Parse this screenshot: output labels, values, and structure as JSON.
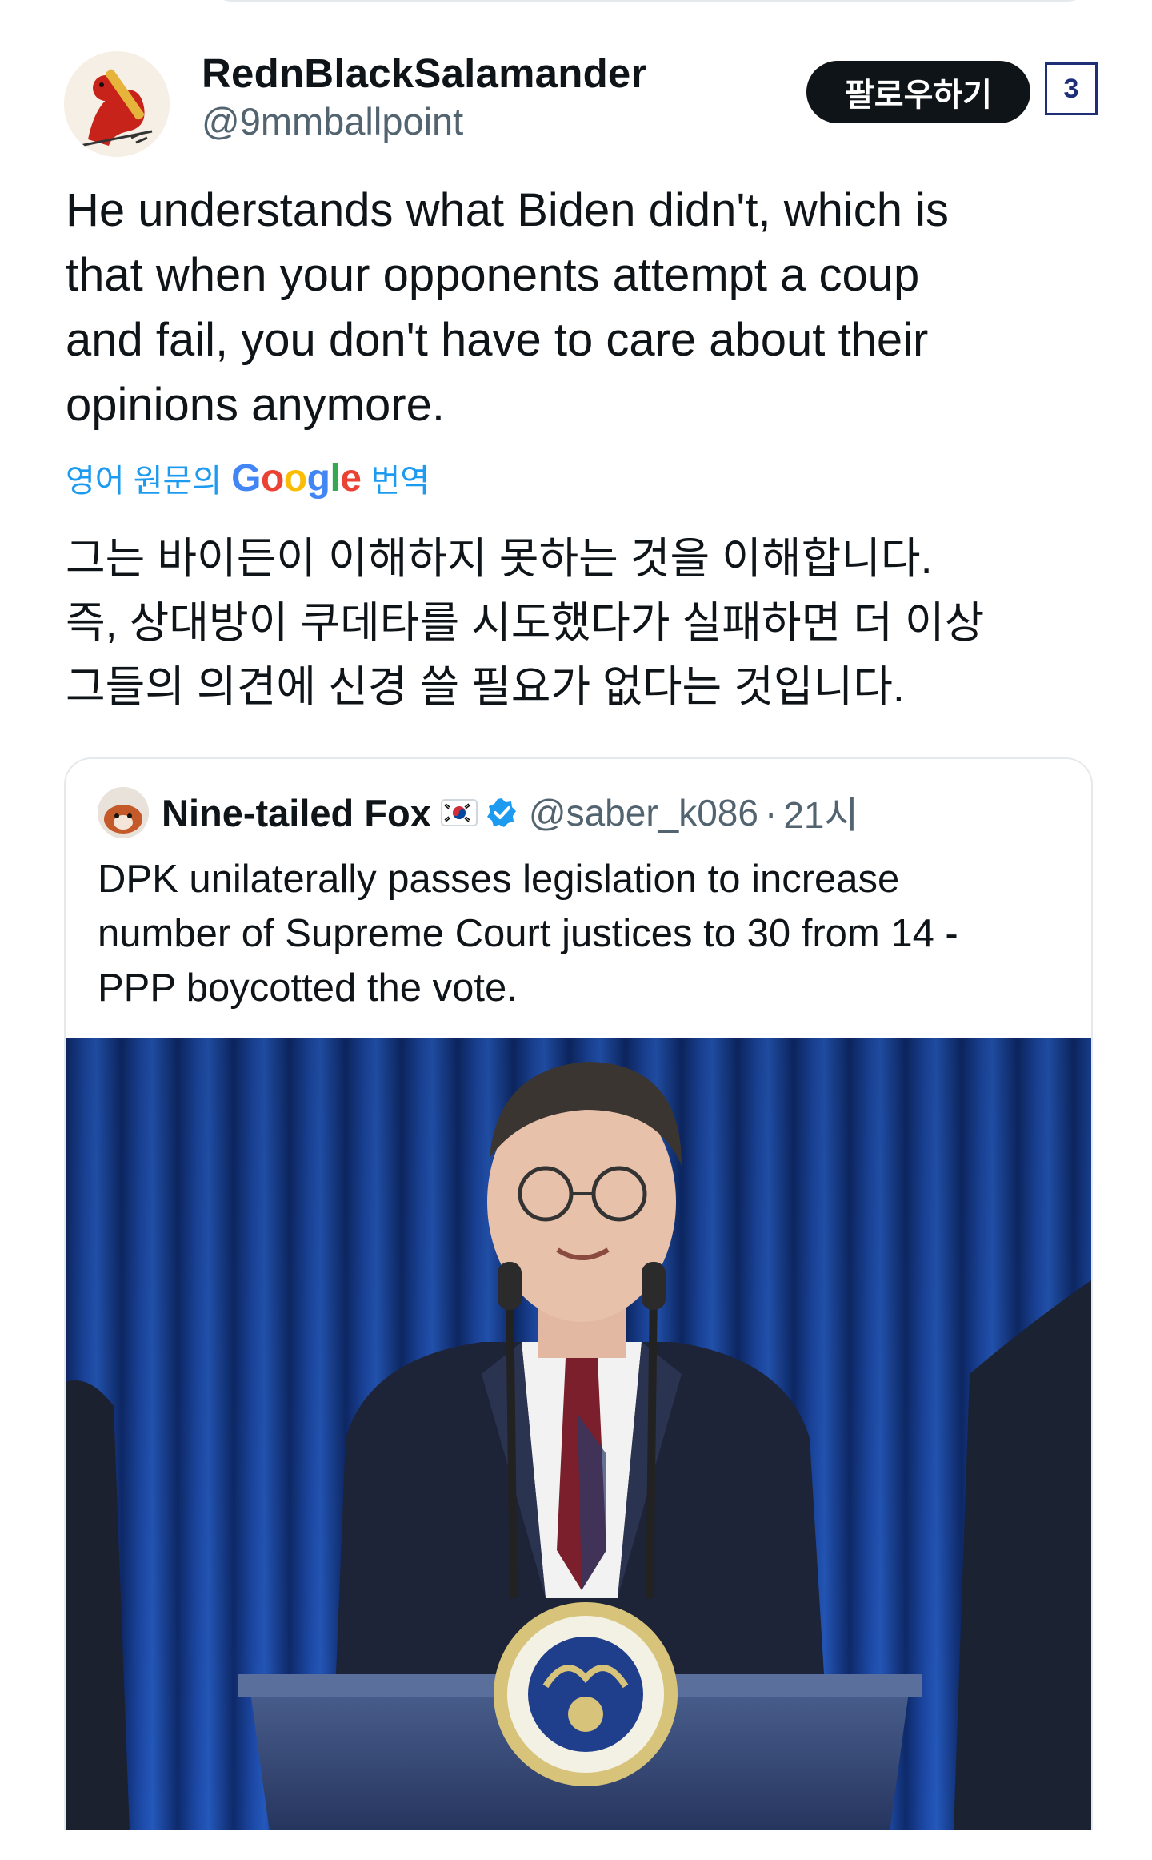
{
  "tweet": {
    "author": {
      "display_name": "RednBlackSalamander",
      "handle": "@9mmballpoint"
    },
    "follow_label": "팔로우하기",
    "page_badge": "3",
    "text_lines": [
      "He understands what Biden didn't, which is",
      "that when your opponents attempt a coup",
      "and fail, you don't have to care about their",
      "opinions anymore."
    ],
    "translate": {
      "prefix": "영어 원문의",
      "google": "Google",
      "suffix": "번역"
    },
    "translated_lines": [
      "그는 바이든이 이해하지 못하는 것을 이해합니다.",
      "즉, 상대방이 쿠데타를 시도했다가 실패하면 더 이상",
      "그들의 의견에 신경 쓸 필요가 없다는 것입니다."
    ]
  },
  "quote": {
    "display_name": "Nine-tailed Fox",
    "handle": "@saber_k086",
    "separator": "·",
    "time": "21시",
    "flag_icon": "south-korea-flag-icon",
    "verified_icon": "verified-badge-icon",
    "text_lines": [
      "DPK unilaterally passes legislation to increase",
      "number of Supreme Court justices to 30 from 14 -",
      "PPP boycotted the vote."
    ]
  },
  "colors": {
    "text": "#0f1419",
    "secondary": "#536471",
    "link": "#1d9bf0",
    "follow_bg": "#0f1419",
    "badge": "#1e2f78",
    "curtain": "#1b3f8f"
  }
}
